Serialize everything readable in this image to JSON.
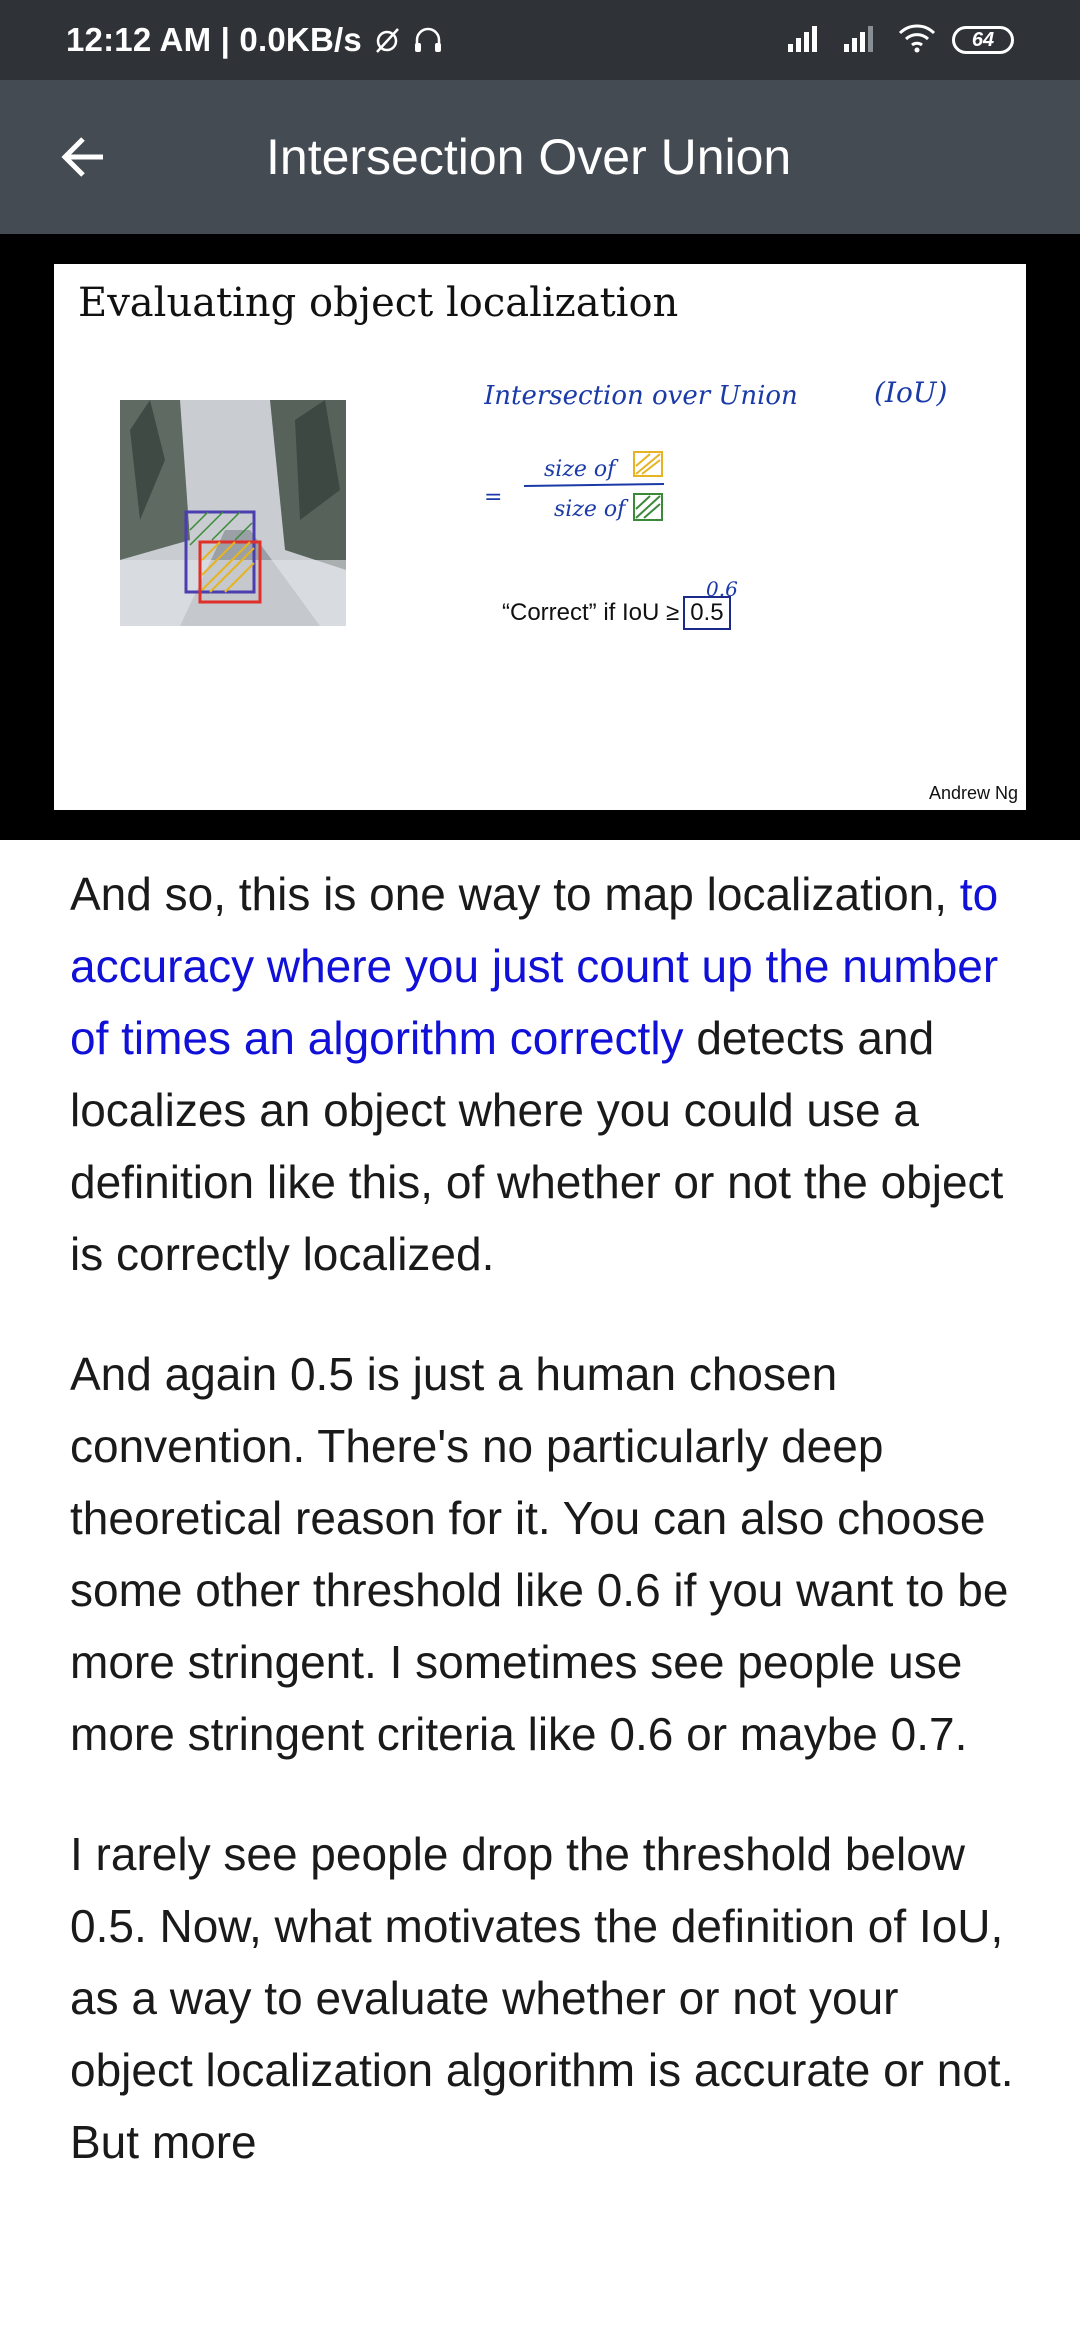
{
  "status_bar": {
    "time_speed": "12:12 AM | 0.0KB/s",
    "battery": "64"
  },
  "app_bar": {
    "title": "Intersection Over Union"
  },
  "slide": {
    "title": "Evaluating object localization",
    "handwriting": {
      "line1": "Intersection over Union",
      "line1_abbr": "(IoU)",
      "numerator": "size of",
      "denominator": "size of",
      "eq": "=",
      "note": "0.6"
    },
    "correct_prefix": "“Correct” if IoU ≥",
    "correct_threshold": "0.5",
    "author": "Andrew Ng",
    "colors": {
      "purple_box": "#4b3fb0",
      "red_box": "#e0302a",
      "green_hatch": "#3a8a3a",
      "yellow_hatch": "#e6b422"
    }
  },
  "article": {
    "p1_before": "And so, this is one way to map localization, ",
    "p1_highlight": "to accuracy where you just count up the number of times an algorithm correctly",
    "p1_after": " detects and localizes an object where you could use a definition like this, of whether or not the object is correctly localized.",
    "p2": "And again 0.5 is just a human chosen convention. There's no particularly deep theoretical reason for it. You can also choose some other threshold like 0.6 if you want to be more stringent. I sometimes see people use more stringent criteria like 0.6 or maybe 0.7.",
    "p3": "I rarely see people drop the threshold below 0.5. Now, what motivates the definition of IoU, as a way to evaluate whether or not your object localization algorithm is accurate or not. But more"
  }
}
